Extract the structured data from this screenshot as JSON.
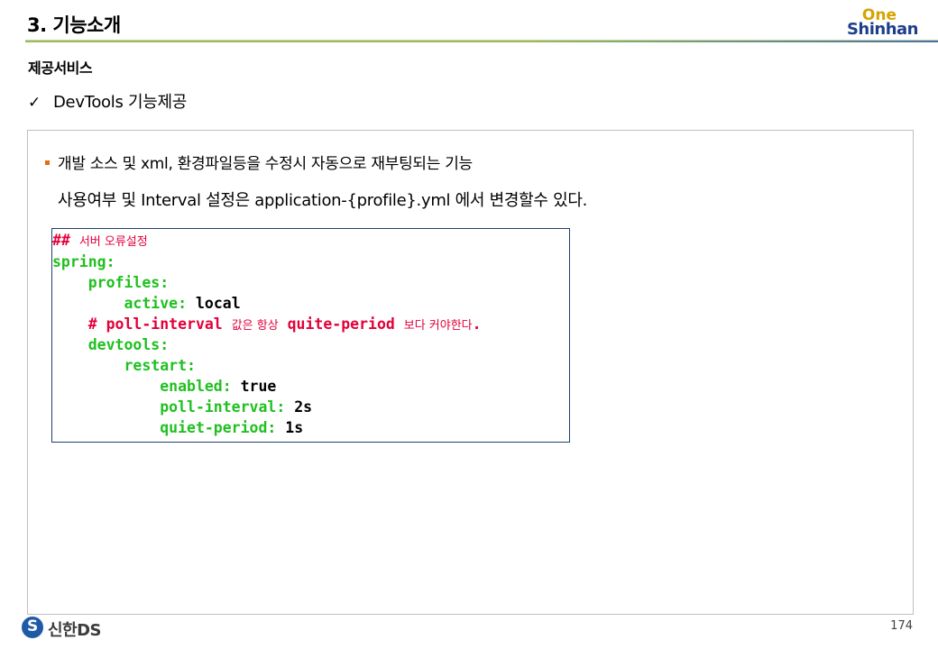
{
  "header": {
    "title": "3. 기능소개",
    "logo_top": "One",
    "logo_bottom": "Shinhan"
  },
  "section": {
    "title": "제공서비스",
    "check_mark": "✓",
    "check_item": "DevTools 기능제공"
  },
  "content": {
    "bullet": "개발 소스 및 xml, 환경파일등을 수정시 자동으로 재부팅되는 기능",
    "sub": "사용여부 및 Interval 설정은 application-{profile}.yml 에서 변경할수 있다."
  },
  "code": {
    "line1_hash": "##",
    "line1_comment": "서버 오류설정",
    "line2": "spring:",
    "line3": "    profiles:",
    "line4_key": "        active: ",
    "line4_val": "local",
    "line5_code": "    # poll-interval ",
    "line5_kor1": "값은 항상",
    "line5_code2": " quite-period ",
    "line5_kor2": "보다 커야한다",
    "line5_dot": ".",
    "line6": "    devtools:",
    "line7": "        restart:",
    "line8_key": "            enabled: ",
    "line8_val": "true",
    "line9_key": "            poll-interval: ",
    "line9_val": "2s",
    "line10_key": "            quiet-period: ",
    "line10_val": "1s"
  },
  "footer": {
    "company": "신한DS",
    "page_number": "174"
  },
  "colors": {
    "bullet_accent": "#e46c0a",
    "code_red": "#e3003a",
    "code_green": "#20c020",
    "logo_gold": "#d8a200",
    "logo_navy": "#1f3f8c"
  }
}
